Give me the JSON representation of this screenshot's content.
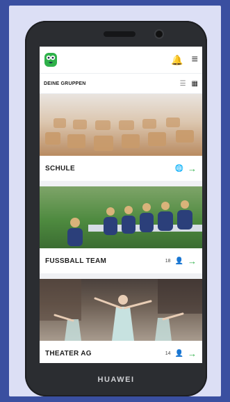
{
  "device": {
    "brand": "HUAWEI"
  },
  "app": {
    "header": {
      "logo_icon": "owl-logo-icon",
      "notification_icon": "bell-icon",
      "menu_icon": "hamburger-menu-icon"
    },
    "section_title": "DEINE GRUPPEN",
    "view_toggles": {
      "list_icon": "list-view-icon",
      "grid_icon": "grid-view-icon",
      "active": "grid"
    },
    "groups": [
      {
        "title": "SCHULE",
        "meta_icon": "globe-icon",
        "count": "",
        "arrow_icon": "arrow-right-icon"
      },
      {
        "title": "FUSSBALL TEAM",
        "meta_icon": "person-icon",
        "count": "18",
        "arrow_icon": "arrow-right-icon"
      },
      {
        "title": "THEATER AG",
        "meta_icon": "person-icon",
        "count": "14",
        "arrow_icon": "arrow-right-icon"
      }
    ]
  },
  "colors": {
    "accent": "#2fb14a",
    "frame": "#3a4fa0",
    "frame_inner": "#dcdff5"
  }
}
